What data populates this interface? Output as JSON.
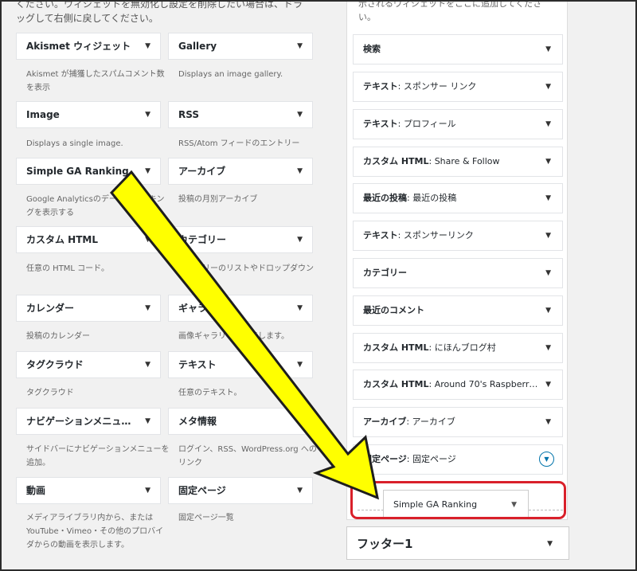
{
  "intro_text": "ください。ウィジェットを無効化し設定を削除したい場合は、ドラッグして右側に戻してください。",
  "widgets": [
    {
      "title": "Akismet ウィジェット",
      "desc": "Akismet が捕獲したスパムコメント数を表示"
    },
    {
      "title": "Gallery",
      "desc": "Displays an image gallery."
    },
    {
      "title": "Image",
      "desc": "Displays a single image."
    },
    {
      "title": "RSS",
      "desc": "RSS/Atom フィードのエントリー"
    },
    {
      "title": "Simple GA Ranking",
      "desc": "Google Analyticsのデータでランキングを表示する"
    },
    {
      "title": "アーカイブ",
      "desc": "投稿の月別アーカイブ"
    },
    {
      "title": "カスタム HTML",
      "desc": "任意の HTML コード。"
    },
    {
      "title": "カテゴリー",
      "desc": "カテゴリーのリストやドロップダウン"
    },
    {
      "title": "カレンダー",
      "desc": "投稿のカレンダー"
    },
    {
      "title": "ギャラリー",
      "desc": "画像ギャラリーを表示します。"
    },
    {
      "title": "タグクラウド",
      "desc": "タグクラウド"
    },
    {
      "title": "テキスト",
      "desc": "任意のテキスト。"
    },
    {
      "title": "ナビゲーションメニュ…",
      "desc": "サイドバーにナビゲーションメニューを追加。"
    },
    {
      "title": "メタ情報",
      "desc": "ログイン、RSS、WordPress.org へのリンク"
    },
    {
      "title": "動画",
      "desc": "メディアライブラリ内から、または YouTube・Vimeo・その他のプロバイダからの動画を表示します。"
    },
    {
      "title": "固定ページ",
      "desc": "固定ページ一覧"
    }
  ],
  "sidebar": {
    "desc": "示されるウィジェットをここに追加してください。",
    "widgets": [
      {
        "name": "検索",
        "sub": ""
      },
      {
        "name": "テキスト",
        "sub": ": スポンサー リンク"
      },
      {
        "name": "テキスト",
        "sub": ": プロフィール"
      },
      {
        "name": "カスタム HTML",
        "sub": ": Share & Follow"
      },
      {
        "name": "最近の投稿",
        "sub": ": 最近の投稿"
      },
      {
        "name": "テキスト",
        "sub": ": スポンサーリンク"
      },
      {
        "name": "カテゴリー",
        "sub": ""
      },
      {
        "name": "最近のコメント",
        "sub": ""
      },
      {
        "name": "カスタム HTML",
        "sub": ": にほんブログ村"
      },
      {
        "name": "カスタム HTML",
        "sub": ": Around 70's Raspberr…"
      },
      {
        "name": "アーカイブ",
        "sub": ": アーカイブ"
      },
      {
        "name": "固定ページ",
        "sub": ": 固定ページ"
      }
    ],
    "dragged_widget": "Simple GA Ranking"
  },
  "footer_area": {
    "title": "フッター1"
  },
  "icons": {
    "collapse": "triangle-down-icon",
    "expand": "circle-down-icon"
  },
  "colors": {
    "highlight": "#d9202a",
    "arrow_fill": "#ffff00",
    "accent": "#0073aa"
  }
}
